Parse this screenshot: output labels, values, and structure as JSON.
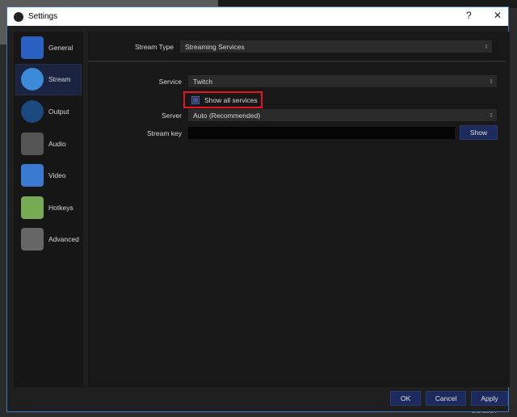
{
  "window": {
    "title": "Settings",
    "help": "?",
    "close": "✕"
  },
  "sidebar": {
    "items": [
      {
        "label": "General",
        "icon": "computer-wrench-icon",
        "color": "#2a60c0"
      },
      {
        "label": "Stream",
        "icon": "globe-icon",
        "color": "#3a8ad8"
      },
      {
        "label": "Output",
        "icon": "antenna-icon",
        "color": "#1c4a80"
      },
      {
        "label": "Audio",
        "icon": "speaker-icon",
        "color": "#555555"
      },
      {
        "label": "Video",
        "icon": "monitor-icon",
        "color": "#3a7ad0"
      },
      {
        "label": "Hotkeys",
        "icon": "keyboard-icon",
        "color": "#77aa55"
      },
      {
        "label": "Advanced",
        "icon": "gears-icon",
        "color": "#666666"
      }
    ],
    "selected": "Stream"
  },
  "stream": {
    "stream_type_label": "Stream Type",
    "stream_type": "Streaming Services",
    "service_label": "Service",
    "service": "Twitch",
    "show_all_label": "Show all services",
    "server_label": "Server",
    "server": "Auto (Recommended)",
    "key_label": "Stream key",
    "key_value": "",
    "show_button": "Show"
  },
  "footer": {
    "ok": "OK",
    "cancel": "Cancel",
    "apply": "Apply"
  },
  "background": {
    "text": "Duration"
  },
  "highlight_color": "#e8141e"
}
